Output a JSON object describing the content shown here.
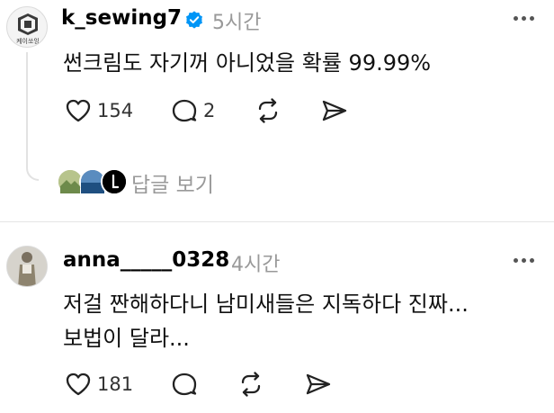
{
  "post": {
    "username": "k_sewing7",
    "time": "5시간",
    "avatar_text": "케이쏘잉",
    "text": "썬크림도 자기꺼 아니었을 확률 99.99%",
    "likes": "154",
    "comments": "2",
    "view_replies": "답글 보기"
  },
  "reply": {
    "username": "anna_____0328",
    "time": "4시간",
    "text_line1": "저걸 짠해하다니 남미새들은 지독하다 진짜...",
    "text_line2": "보법이 달라...",
    "likes": "181"
  },
  "colors": {
    "verified": "#0095f6",
    "muted": "#999999"
  }
}
